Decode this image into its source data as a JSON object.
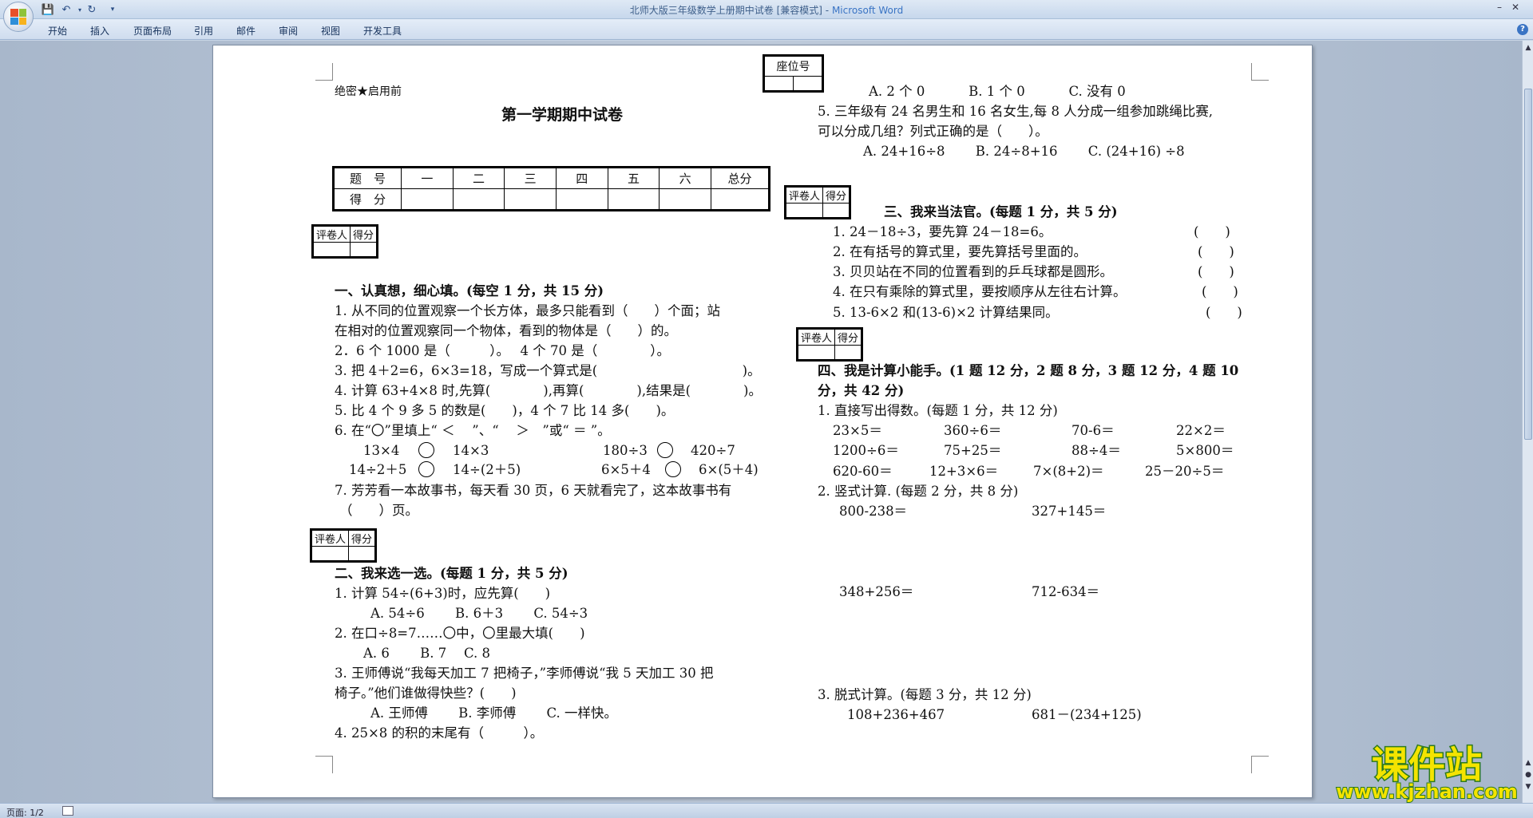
{
  "window": {
    "title": "北师大版三年级数学上册期中试卷 [兼容模式]",
    "title_sep": " - ",
    "app_name": "Microsoft Word"
  },
  "ribbon": {
    "tabs": [
      "开始",
      "插入",
      "页面布局",
      "引用",
      "邮件",
      "审阅",
      "视图",
      "开发工具"
    ]
  },
  "status": {
    "page": "页面: 1/2"
  },
  "doc": {
    "seat_label": "座位号",
    "secret": "绝密★启用前",
    "title": "第一学期期中试卷",
    "score_table": {
      "headers": [
        "题　号",
        "一",
        "二",
        "三",
        "四",
        "五",
        "六",
        "总分"
      ],
      "row2_label": "得　分"
    },
    "grader": {
      "person": "评卷人",
      "score": "得分"
    },
    "sec1": {
      "title": "一、认真想，细心填。(每空 1 分，共 15 分)",
      "q1a": "1. 从不同的位置观察一个长方体，最多只能看到（　　）个面；站",
      "q1b": "在相对的位置观察同一个物体，看到的物体是（　　）的。",
      "q2": "2．6 个 1000 是（　　　）。　 4 个 70 是（　　　　）。",
      "q3": "3. 把 4＋2=6，6×3=18，写成一个算式是(　　　　　　　　　　　)。",
      "q4": "4. 计算 63+4×8 时,先算(　　　　),再算(　　　　),结果是(　　　　)。",
      "q5": "5. 比 4 个 9 多 5 的数是(　　)，4 个 7 比 14 多(　　)。",
      "q6": "6. 在“〇”里填上“ ＜　 ”、“　 ＞　”或“ ＝ ”。",
      "q6_items": [
        "13×4",
        "14×3",
        "180÷3",
        "420÷7",
        "14÷2＋5",
        "14÷(2＋5)",
        "6×5＋4",
        "6×(5＋4)"
      ],
      "q7a": "7. 芳芳看一本故事书，每天看 30 页，6 天就看完了，这本故事书有",
      "q7b": "（　　）页。"
    },
    "sec2": {
      "title": "二、我来选一选。(每题 1 分，共 5 分)",
      "q1": "1. 计算 54÷(6+3)时，应先算(　　)",
      "q1_opts": "A. 54÷6　　 B. 6＋3　　 C. 54÷3",
      "q2": "2. 在口÷8=7……〇中，〇里最大填(　　)",
      "q2_opts": "A. 6　　 B. 7　 C. 8",
      "q3a": "3. 王师傅说“我每天加工 7 把椅子，”李师傅说“我 5 天加工 30 把",
      "q3b": "椅子。”他们谁做得快些？(　　)",
      "q3_opts": "A. 王师傅　　 B. 李师傅　　 C. 一样快。",
      "q4": "4. 25×8 的积的末尾有（　　　）。",
      "q4_opts": "A. 2 个 0　　　 B. 1 个 0　　　 C. 没有 0",
      "q5a": "5. 三年级有 24 名男生和 16 名女生,每 8 人分成一组参加跳绳比赛,",
      "q5b": "可以分成几组？列式正确的是（　　）。",
      "q5_opts": "A. 24+16÷8　　 B. 24÷8+16　　 C. (24+16) ÷8"
    },
    "sec3": {
      "title": "三、我来当法官。(每题 1 分，共 5 分)",
      "items": [
        "1. 24－18÷3，要先算 24－18=6。",
        "2. 在有括号的算式里，要先算括号里面的。",
        "3. 贝贝站在不同的位置看到的乒乓球都是圆形。",
        "4. 在只有乘除的算式里，要按顺序从左往右计算。",
        "5. 13-6×2 和(13-6)×2 计算结果同。"
      ],
      "paren": "(　　)"
    },
    "sec4": {
      "title_a": "四、我是计算小能手。(1 题 12 分，2 题 8 分，3 题 12 分，4 题 10",
      "title_b": "分，共 42 分)",
      "p1": "1. 直接写出得数。(每题 1 分，共 12 分)",
      "p1_rows": [
        [
          "23×5＝",
          "360÷6＝",
          "70-6＝",
          "22×2＝"
        ],
        [
          "1200÷6＝",
          "75+25＝",
          "88÷4＝",
          "5×800＝"
        ],
        [
          "620-60＝",
          "12+3×6＝",
          "7×(8+2)＝",
          "25－20÷5＝"
        ]
      ],
      "p2": "2. 竖式计算. (每题 2 分，共 8 分)",
      "p2_a": [
        "800-238＝",
        "327+145＝"
      ],
      "p2_b": [
        "348+256＝",
        "712-634＝"
      ],
      "p3": "3. 脱式计算。(每题 3 分，共 12 分)",
      "p3_a": [
        "108+236+467",
        "681－(234+125)"
      ]
    }
  },
  "watermark": {
    "cn": "课件站",
    "url": "www.kjzhan.com",
    "fill": "#f4e400",
    "outline": "#2b7a1e"
  }
}
